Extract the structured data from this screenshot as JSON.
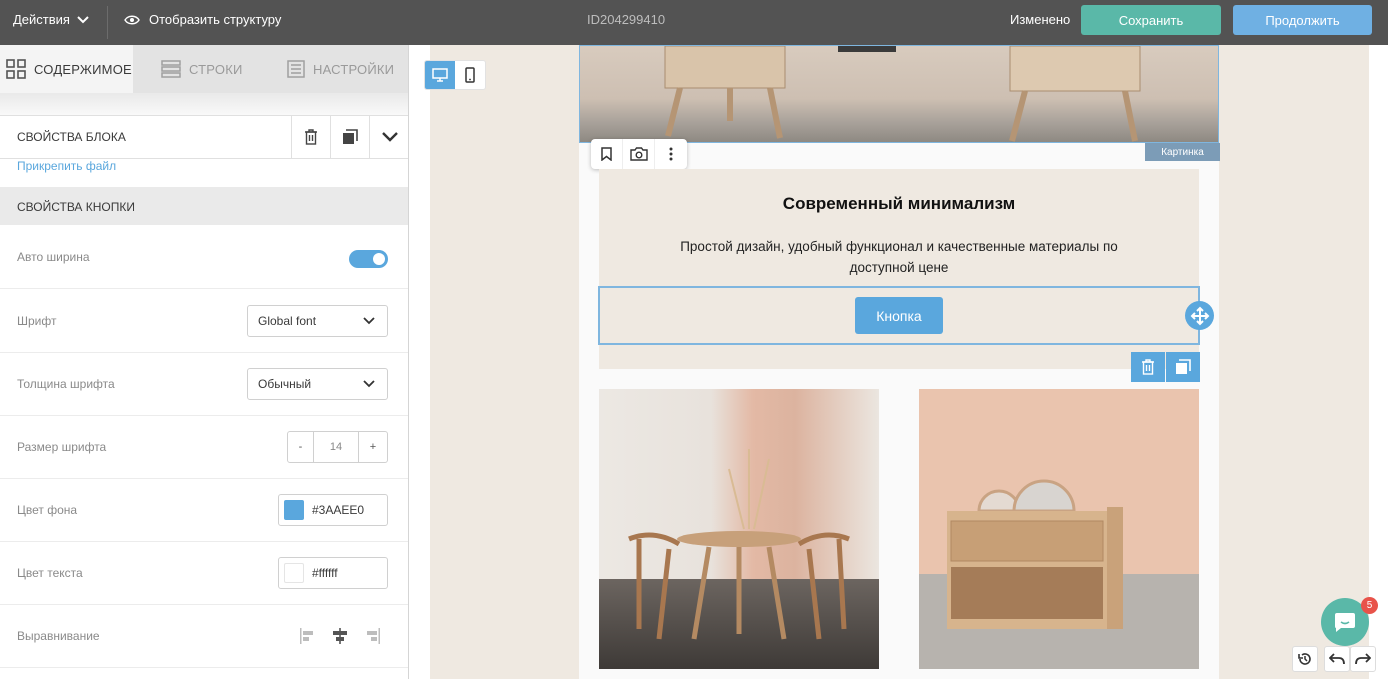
{
  "topbar": {
    "actions_label": "Действия",
    "structure_label": "Отобразить структуру",
    "doc_id": "ID204299410",
    "status": "Изменено",
    "save_label": "Сохранить",
    "continue_label": "Продолжить"
  },
  "tabs": [
    {
      "label": "СОДЕРЖИМОЕ",
      "icon": "grid-icon",
      "active": true
    },
    {
      "label": "СТРОКИ",
      "icon": "rows-icon",
      "active": false
    },
    {
      "label": "НАСТРОЙКИ",
      "icon": "settings-doc-icon",
      "active": false
    }
  ],
  "panel": {
    "block_props_title": "СВОЙСТВА БЛОКА",
    "attach_file": "Прикрепить файл",
    "button_props_title": "СВОЙСТВА КНОПКИ",
    "rows": {
      "auto_width": {
        "label": "Авто ширина",
        "value": true
      },
      "font": {
        "label": "Шрифт",
        "value": "Global font"
      },
      "font_weight": {
        "label": "Толщина шрифта",
        "value": "Обычный"
      },
      "font_size": {
        "label": "Размер шрифта",
        "value": "14",
        "minus": "-",
        "plus": "+"
      },
      "bg_color": {
        "label": "Цвет фона",
        "value": "#3AAEE0",
        "swatch": "#5aa7dd"
      },
      "text_color": {
        "label": "Цвет текста",
        "value": "#ffffff",
        "swatch": "#ffffff"
      },
      "alignment": {
        "label": "Выравнивание"
      }
    }
  },
  "canvas": {
    "image_label": "Картинка",
    "heading": "Современный минимализм",
    "subtext": "Простой дизайн, удобный функционал и качественные материалы по доступной цене",
    "button_text": "Кнопка"
  },
  "chat": {
    "badge": "5"
  },
  "colors": {
    "accent": "#5aa7dd",
    "save": "#5ab8a8",
    "topbar": "#535353"
  }
}
